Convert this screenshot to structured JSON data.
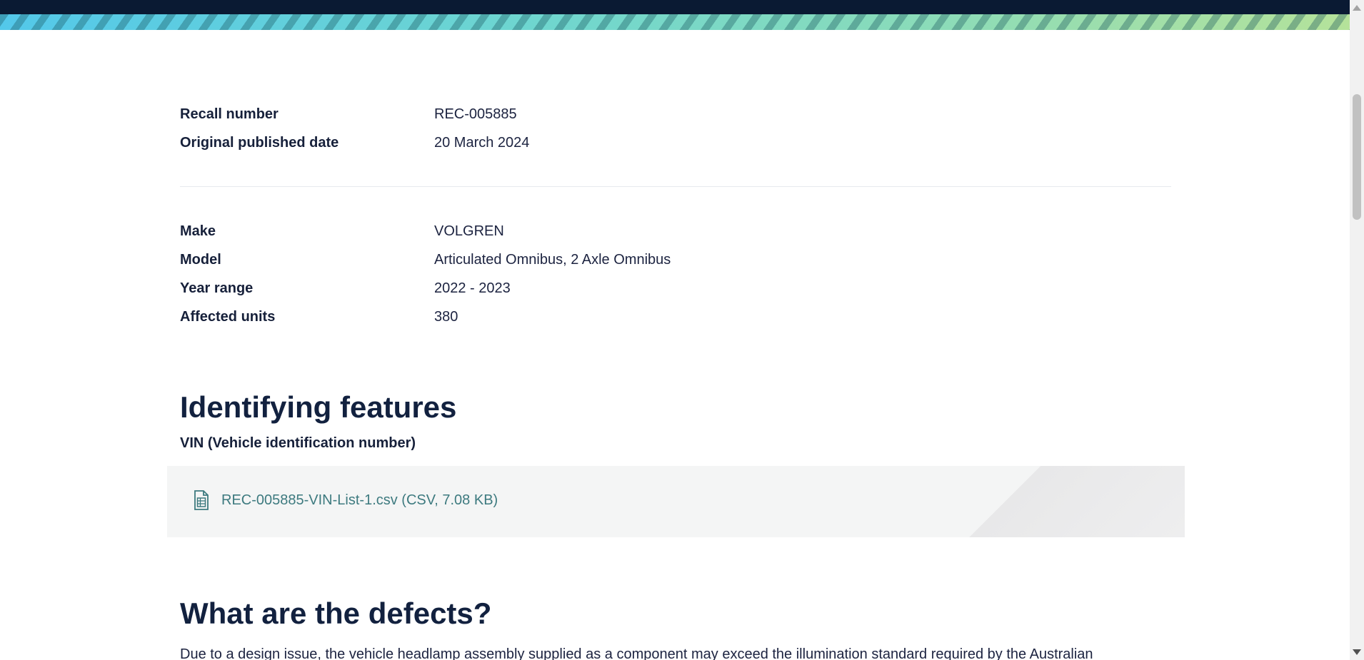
{
  "recall_details": [
    {
      "label": "Recall number",
      "value": "REC-005885"
    },
    {
      "label": "Original published date",
      "value": "20 March 2024"
    }
  ],
  "vehicle_details": [
    {
      "label": "Make",
      "value": "VOLGREN"
    },
    {
      "label": "Model",
      "value": "Articulated Omnibus, 2 Axle Omnibus"
    },
    {
      "label": "Year range",
      "value": "2022 - 2023"
    },
    {
      "label": "Affected units",
      "value": "380"
    }
  ],
  "identifying": {
    "heading": "Identifying features",
    "subheading": "VIN (Vehicle identification number)",
    "file_link": "REC-005885-VIN-List-1.csv (CSV, 7.08 KB)",
    "file_icon": "spreadsheet-file-icon"
  },
  "defects": {
    "heading": "What are the defects?",
    "body": "Due to a design issue, the vehicle headlamp assembly supplied as a component may exceed the illumination standard required by the Australian"
  },
  "colors": {
    "navy": "#0a1a33",
    "text": "#1c2340",
    "link": "#3d7a7f",
    "file_box_bg": "#f4f5f5"
  }
}
